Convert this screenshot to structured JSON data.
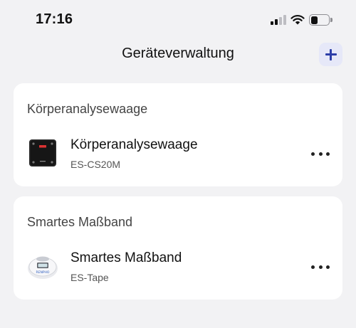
{
  "status_bar": {
    "time": "17:16"
  },
  "header": {
    "title": "Geräteverwaltung",
    "add_icon": "plus-icon"
  },
  "colors": {
    "background": "#f2f2f4",
    "card": "#ffffff",
    "accent": "#2d3ea8",
    "accent_bg": "#e6e8f8"
  },
  "sections": [
    {
      "header": "Körperanalysewaage",
      "device": {
        "name": "Körperanalysewaage",
        "model": "ES-CS20M",
        "image": "body-scale-image",
        "more_icon": "ellipsis-icon"
      }
    },
    {
      "header": "Smartes Maßband",
      "device": {
        "name": "Smartes Maßband",
        "model": "ES-Tape",
        "image": "measuring-tape-image",
        "image_brand": "RENPHO",
        "more_icon": "ellipsis-icon"
      }
    }
  ]
}
